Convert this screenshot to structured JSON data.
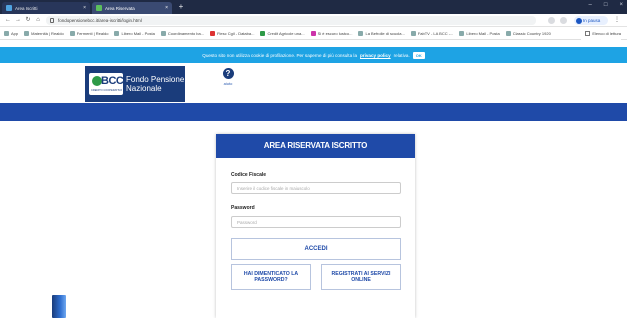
{
  "browser": {
    "tabs": [
      {
        "title": "Area Iscritti",
        "active": false
      },
      {
        "title": "Area Riservata",
        "active": true
      }
    ],
    "new_tab_symbol": "+",
    "url": "fondopensionebcc.it/area-iscritti/login.html",
    "profile_label": "In pausa",
    "bookmarks": [
      "App",
      "Maternità | Realdo",
      "Fermenti | Realdo",
      "Libero Mail - Posta",
      "Coordinamento ba...",
      "Fiesc Cgil - Databa...",
      "Credit Agricole una...",
      "Si è escuro lustco...",
      "La Befrolle di scuola...",
      "FabTV - LA BCC -...",
      "Libero Mail - Posta",
      "Classic Country 1920"
    ],
    "reading_list_label": "Elenco di lettura"
  },
  "cookie_banner": {
    "text": "Questo sito non utilizza cookie di profilazione. Per saperne di più consulta la",
    "link": "privacy policy",
    "suffix": "relativa.",
    "ok_label": "OK"
  },
  "header": {
    "logo_mark": "BCC",
    "logo_sub": "CREDITO COOPERATIVO",
    "logo_text_line1": "Fondo Pensione",
    "logo_text_line2": "Nazionale",
    "help_symbol": "?",
    "help_label": "aiuto"
  },
  "login": {
    "title": "AREA RISERVATA ISCRITTO",
    "fiscal_code_label": "Codice Fiscale",
    "fiscal_code_placeholder": "Inserire il codice fiscale in maiuscolo",
    "fiscal_code_value": "",
    "password_label": "Password",
    "password_placeholder": "Password",
    "password_value": "",
    "submit_label": "ACCEDI",
    "forgot_label": "HAI DIMENTICATO LA PASSWORD?",
    "register_label": "REGISTRATI AI SERVIZI ONLINE"
  },
  "colors": {
    "brand_blue": "#1f4aa8",
    "banner_blue": "#1ea3e4",
    "logo_navy": "#1a3c7b"
  }
}
